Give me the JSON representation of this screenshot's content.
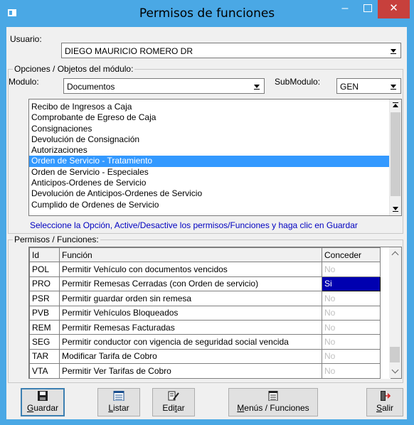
{
  "window": {
    "title": "Permisos de funciones",
    "controls": {
      "minimize": "–",
      "close": "✕"
    }
  },
  "usuario": {
    "label": "Usuario:",
    "value": "DIEGO MAURICIO ROMERO DR"
  },
  "opciones": {
    "group_title": "Opciones / Objetos del módulo:",
    "modulo_label": "Modulo:",
    "modulo_value": "Documentos",
    "submodulo_label": "SubModulo:",
    "submodulo_value": "GEN",
    "items": [
      "Recibo de Ingresos a Caja",
      "Comprobante de Egreso de Caja",
      "Consignaciones",
      "Devolución de Consignación",
      "Autorizaciones",
      "Orden de Servicio - Tratamiento",
      "Orden de Servicio - Especiales",
      "Anticipos-Ordenes de Servicio",
      "Devolución de Anticipos-Ordenes de Servicio",
      "Cumplido de Ordenes de Servicio"
    ],
    "selected_index": 5,
    "hint": "Seleccione la Opción, Active/Desactive los permisos/Funciones y haga clic en Guardar"
  },
  "permisos": {
    "group_title": "Permisos / Funciones:",
    "columns": {
      "id": "Id",
      "funcion": "Función",
      "conceder": "Conceder"
    },
    "rows": [
      {
        "id": "POL",
        "funcion": "Permitir Vehículo con documentos vencidos",
        "conceder": "No"
      },
      {
        "id": "PRO",
        "funcion": "Permitir Remesas Cerradas (con Orden de servicio)",
        "conceder": "Si"
      },
      {
        "id": "PSR",
        "funcion": "Permitir guardar orden sin remesa",
        "conceder": "No"
      },
      {
        "id": "PVB",
        "funcion": "Permitir Vehículos Bloqueados",
        "conceder": "No"
      },
      {
        "id": "REM",
        "funcion": "Permitir Remesas Facturadas",
        "conceder": "No"
      },
      {
        "id": "SEG",
        "funcion": "Permitir conductor con vigencia de seguridad social vencida",
        "conceder": "No"
      },
      {
        "id": "TAR",
        "funcion": "Modificar Tarifa de Cobro",
        "conceder": "No"
      },
      {
        "id": "VTA",
        "funcion": "Permitir Ver Tarifas de Cobro",
        "conceder": "No"
      }
    ]
  },
  "buttons": {
    "guardar": {
      "accel": "G",
      "rest": "uardar",
      "icon": "floppy-disk-icon"
    },
    "listar": {
      "accel": "L",
      "rest": "istar",
      "icon": "list-icon"
    },
    "editar": {
      "pre": "Edi",
      "accel": "t",
      "rest": "ar",
      "icon": "edit-icon"
    },
    "menus": {
      "accel": "M",
      "rest": "enús / Funciones",
      "icon": "menu-icon"
    },
    "salir": {
      "accel": "S",
      "rest": "alir",
      "icon": "exit-door-icon"
    }
  },
  "colors": {
    "titlebar": "#4aa8e5",
    "close_button": "#c7403c",
    "selection": "#3399ff",
    "si_cell": "#0000b0",
    "hint_text": "#0000c0"
  }
}
